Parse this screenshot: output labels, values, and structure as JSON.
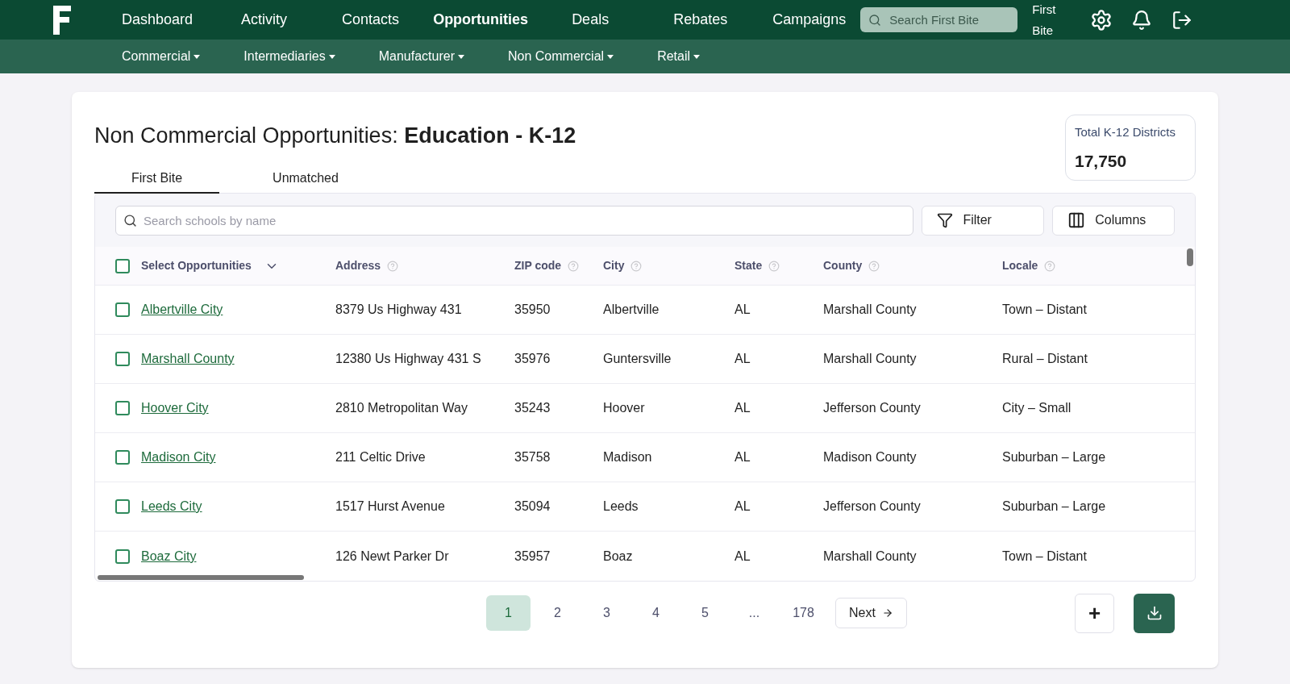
{
  "nav": {
    "items": [
      {
        "label": "Dashboard",
        "selected": false
      },
      {
        "label": "Activity",
        "selected": false
      },
      {
        "label": "Contacts",
        "selected": false
      },
      {
        "label": "Opportunities",
        "selected": true
      },
      {
        "label": "Deals",
        "selected": false
      },
      {
        "label": "Rebates",
        "selected": false
      },
      {
        "label": "Campaigns",
        "selected": false
      }
    ],
    "search": {
      "placeholder": "Search First Bite"
    },
    "account": "First Bite"
  },
  "subnav": [
    "Commercial",
    "Intermediaries",
    "Manufacturer",
    "Non Commercial",
    "Retail"
  ],
  "page": {
    "title": "Non Commercial Opportunities: **Education - K-12**"
  },
  "stat": {
    "label": "Total K-12 Districts",
    "value": "17,750"
  },
  "tabs": [
    {
      "label": "First Bite",
      "selected": true
    },
    {
      "label": "Unmatched",
      "selected": false
    }
  ],
  "toolbar": {
    "search": {
      "placeholder": "Search schools by name"
    },
    "buttons": [
      "Filter",
      "Columns"
    ]
  },
  "table": {
    "select_label": "Select Opportunities",
    "select_all_checked": false,
    "columns": [
      "Address",
      "ZIP code",
      "City",
      "State",
      "County",
      "Locale"
    ],
    "rows": [
      {
        "name": "Albertville City",
        "checked": false,
        "cells": [
          "8379 Us Highway 431",
          "35950",
          "Albertville",
          "AL",
          "Marshall County",
          "Town – Distant"
        ]
      },
      {
        "name": "Marshall County",
        "checked": false,
        "cells": [
          "12380 Us Highway 431 S",
          "35976",
          "Guntersville",
          "AL",
          "Marshall County",
          "Rural – Distant"
        ]
      },
      {
        "name": "Hoover City",
        "checked": false,
        "cells": [
          "2810 Metropolitan Way",
          "35243",
          "Hoover",
          "AL",
          "Jefferson County",
          "City – Small"
        ]
      },
      {
        "name": "Madison City",
        "checked": false,
        "cells": [
          "211 Celtic Drive",
          "35758",
          "Madison",
          "AL",
          "Madison County",
          "Suburban – Large"
        ]
      },
      {
        "name": "Leeds City",
        "checked": false,
        "cells": [
          "1517 Hurst Avenue",
          "35094",
          "Leeds",
          "AL",
          "Jefferson County",
          "Suburban – Large"
        ]
      },
      {
        "name": "Boaz City",
        "checked": false,
        "cells": [
          "126 Newt Parker Dr",
          "35957",
          "Boaz",
          "AL",
          "Marshall County",
          "Town – Distant"
        ]
      }
    ]
  },
  "pagination": {
    "pages": [
      {
        "label": "1",
        "selected": true
      },
      {
        "label": "2",
        "selected": false
      },
      {
        "label": "3",
        "selected": false
      },
      {
        "label": "4",
        "selected": false
      },
      {
        "label": "5",
        "selected": false
      },
      {
        "label": "...",
        "selected": false
      },
      {
        "label": "178",
        "selected": false
      }
    ],
    "next": "Next"
  },
  "actions": {
    "add": "+"
  }
}
